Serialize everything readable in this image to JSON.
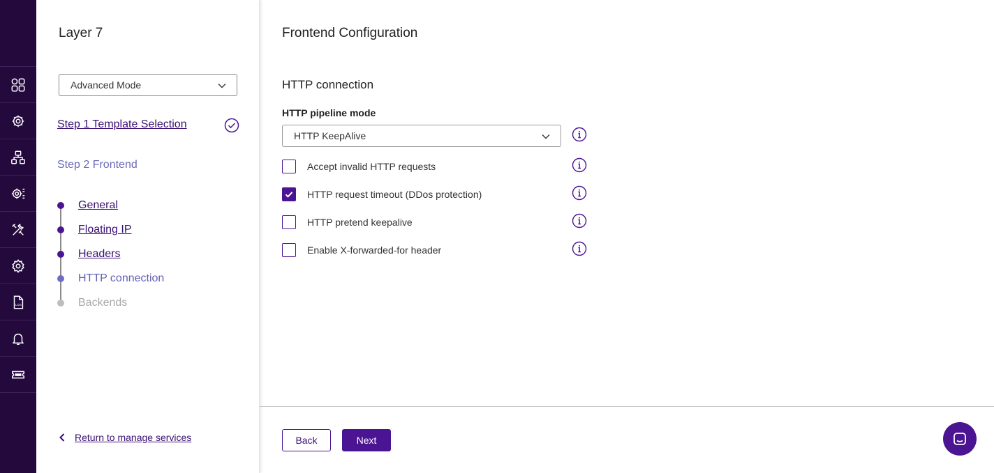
{
  "rail": {
    "items": [
      {
        "icon": "dashboard-grid-icon"
      },
      {
        "icon": "services-icon"
      },
      {
        "icon": "network-icon"
      },
      {
        "icon": "system-settings-icon"
      },
      {
        "icon": "tools-icon"
      },
      {
        "icon": "settings-gear-icon"
      },
      {
        "icon": "log-file-icon"
      },
      {
        "icon": "notifications-bell-icon"
      },
      {
        "icon": "ticket-icon"
      }
    ]
  },
  "steps": {
    "title": "Layer 7",
    "mode_select": {
      "value": "Advanced Mode"
    },
    "step1": {
      "label": "Step 1 Template Selection",
      "status": "complete"
    },
    "step2": {
      "label": "Step 2 Frontend"
    },
    "substeps": [
      {
        "label": "General",
        "state": "done"
      },
      {
        "label": "Floating IP",
        "state": "done"
      },
      {
        "label": "Headers",
        "state": "done"
      },
      {
        "label": "HTTP connection",
        "state": "current"
      },
      {
        "label": "Backends",
        "state": "future"
      }
    ],
    "return_link": "Return to manage services"
  },
  "main": {
    "title": "Frontend Configuration",
    "section": "HTTP connection",
    "pipeline": {
      "label": "HTTP pipeline mode",
      "value": "HTTP KeepAlive"
    },
    "options": [
      {
        "label": "Accept invalid HTTP requests",
        "checked": false
      },
      {
        "label": "HTTP request timeout (DDos protection)",
        "checked": true
      },
      {
        "label": "HTTP pretend keepalive",
        "checked": false
      },
      {
        "label": "Enable X-forwarded-for header",
        "checked": false
      }
    ],
    "buttons": {
      "back": "Back",
      "next": "Next"
    }
  },
  "colors": {
    "rail_bg": "#24093d",
    "accent": "#4b1493",
    "link": "#3a0f73",
    "current_step": "#6060b5"
  }
}
